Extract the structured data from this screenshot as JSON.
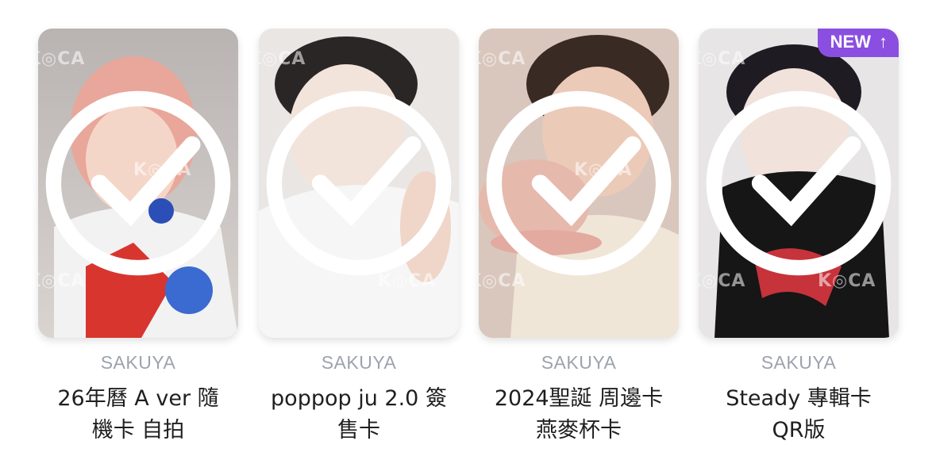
{
  "cards": [
    {
      "artist": "SAKUYA",
      "title_line1": "26年曆 A ver 隨",
      "title_line2": "機卡 自拍",
      "collected": true,
      "is_new": false,
      "icon": "check-circle-icon"
    },
    {
      "artist": "SAKUYA",
      "title_line1": "poppop ju 2.0 簽",
      "title_line2": "售卡",
      "collected": true,
      "is_new": false,
      "icon": "check-circle-icon"
    },
    {
      "artist": "SAKUYA",
      "title_line1": "2024聖誕 周邊卡",
      "title_line2": "燕麥杯卡",
      "collected": true,
      "is_new": false,
      "icon": "check-circle-icon"
    },
    {
      "artist": "SAKUYA",
      "title_line1": "Steady 專輯卡",
      "title_line2": "QR版",
      "collected": true,
      "is_new": true,
      "new_label": "NEW",
      "new_arrow": "↑",
      "icon": "check-circle-icon"
    }
  ],
  "watermark": "K◎CA",
  "colors": {
    "new_badge": "#8a4fe0",
    "artist_text": "#9ea2ad",
    "title_text": "#1f1f1f"
  }
}
